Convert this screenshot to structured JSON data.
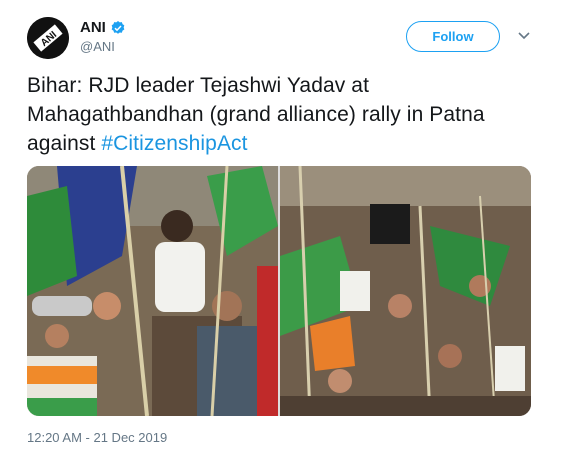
{
  "tweet": {
    "author": {
      "name": "ANI",
      "handle": "@ANI",
      "avatar_text": "ANI",
      "verified": true
    },
    "follow_label": "Follow",
    "text": "Bihar: RJD leader Tejashwi Yadav at Mahagathbandhan (grand alliance) rally in Patna against ",
    "hashtag": "#CitizenshipAct",
    "timestamp": "12:20 AM - 21 Dec 2019",
    "media": [
      {
        "subject": "crowd-rally-photo-left"
      },
      {
        "subject": "crowd-rally-photo-right"
      }
    ]
  },
  "colors": {
    "accent": "#1da1f2",
    "hashtag": "#1b95e0",
    "muted": "#657786",
    "text": "#14171a"
  },
  "icons": {
    "verified": "verified-badge-icon",
    "more": "chevron-down-icon"
  }
}
